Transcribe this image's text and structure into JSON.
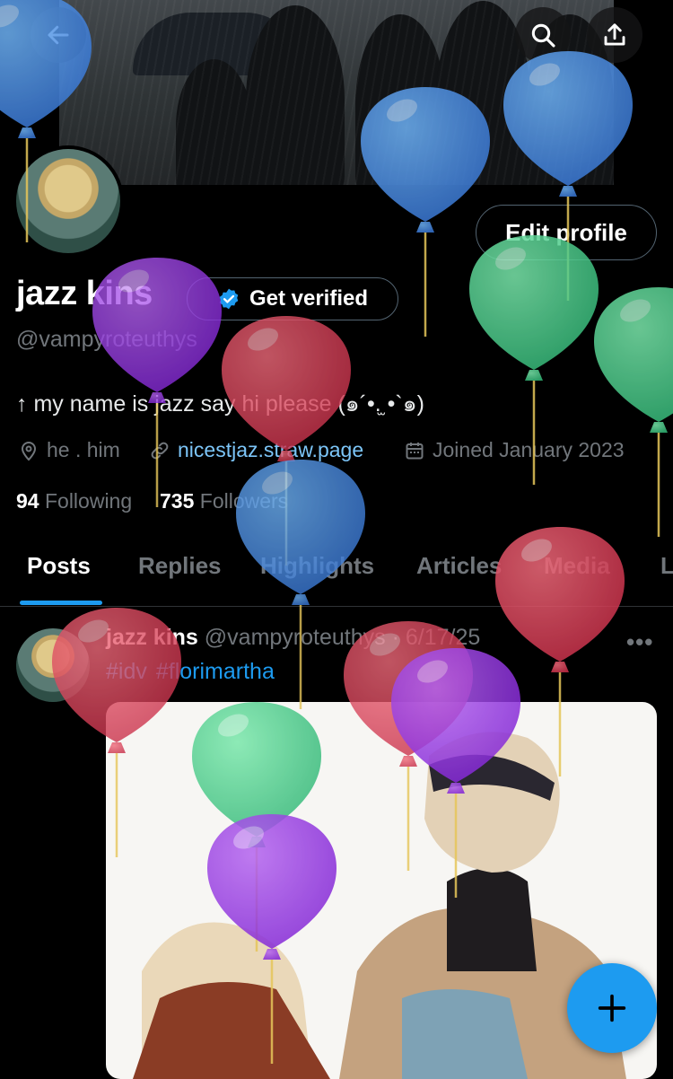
{
  "header": {
    "back_icon": "arrow-left-icon",
    "search_icon": "search-icon",
    "share_icon": "share-icon"
  },
  "profile": {
    "edit_label": "Edit profile",
    "name": "jazz kins",
    "verify_label": "Get verified",
    "handle": "@vampyroteuthys",
    "bio": "↑ my name is jazz say hi please (๑´•.̫ •`๑)",
    "pronouns": "he . him",
    "website": "nicestjaz.straw.page",
    "joined": "Joined January 2023",
    "following_count": "94",
    "following_label": "Following",
    "followers_count": "735",
    "followers_label": "Followers"
  },
  "tabs": [
    {
      "label": "Posts",
      "active": true
    },
    {
      "label": "Replies"
    },
    {
      "label": "Highlights"
    },
    {
      "label": "Articles"
    },
    {
      "label": "Media"
    },
    {
      "label": "L"
    }
  ],
  "post": {
    "name": "jazz kins",
    "handle_date": "@vampyroteuthys · 6/17/25",
    "more": "•••",
    "tags": [
      "#idv",
      "#florimartha"
    ]
  },
  "fab_icon": "plus-icon",
  "colors": {
    "accent": "#1d9bf0",
    "balloon_blue": "#4a8fe0",
    "balloon_green": "#4fcf8a",
    "balloon_red": "#e04559",
    "balloon_purple": "#9b3fe0"
  }
}
